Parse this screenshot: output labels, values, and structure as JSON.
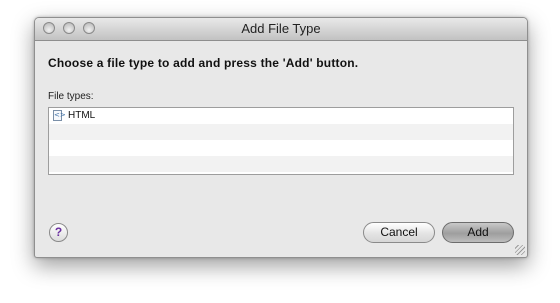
{
  "window": {
    "title": "Add File Type"
  },
  "dialog": {
    "instruction": "Choose a file type to add and press the 'Add' button.",
    "list_label": "File types:",
    "file_types": [
      {
        "label": "HTML",
        "icon": "html-file-icon"
      }
    ]
  },
  "buttons": {
    "help_label": "?",
    "cancel_label": "Cancel",
    "add_label": "Add"
  },
  "colors": {
    "window_background": "#e8e8e8",
    "help_glyph": "#6a2fa0"
  }
}
